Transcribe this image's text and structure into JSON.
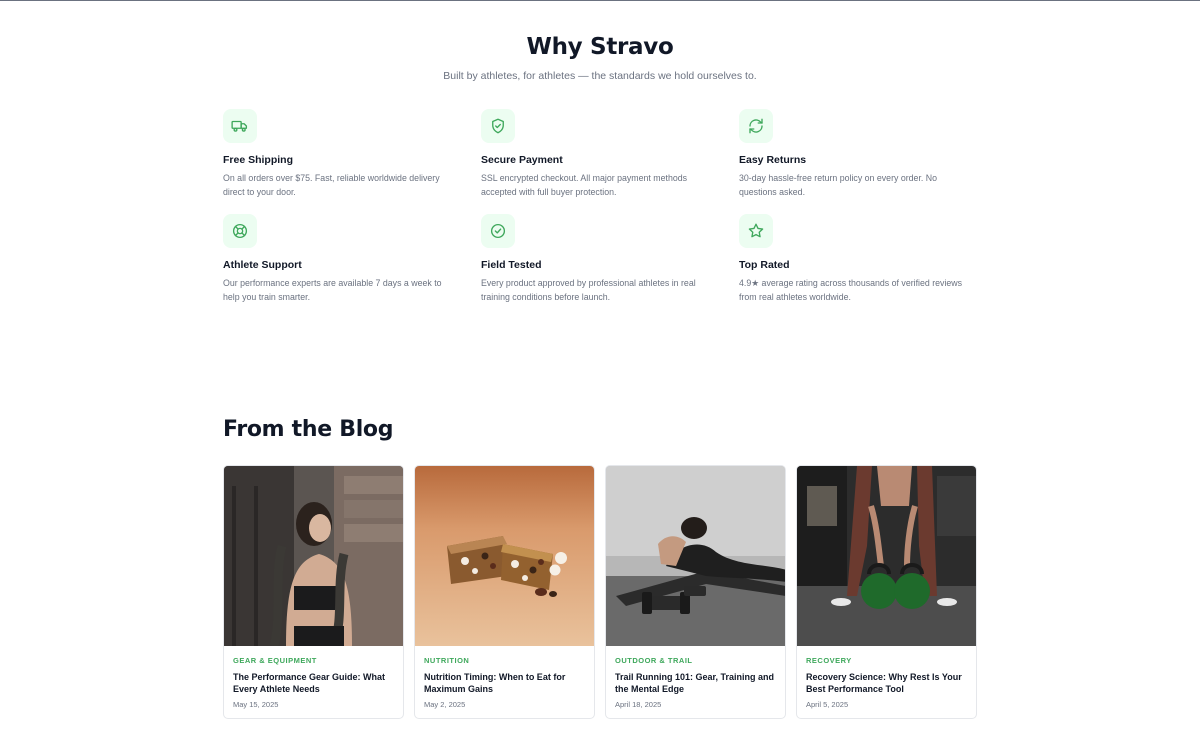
{
  "why": {
    "title": "Why Stravo",
    "subtitle": "Built by athletes, for athletes — the standards we hold ourselves to.",
    "features": [
      {
        "icon": "truck-icon",
        "title": "Free Shipping",
        "desc": "On all orders over $75. Fast, reliable worldwide delivery direct to your door."
      },
      {
        "icon": "shield-icon",
        "title": "Secure Payment",
        "desc": "SSL encrypted checkout. All major payment methods accepted with full buyer protection."
      },
      {
        "icon": "refresh-icon",
        "title": "Easy Returns",
        "desc": "30-day hassle-free return policy on every order. No questions asked."
      },
      {
        "icon": "lifebuoy-icon",
        "title": "Athlete Support",
        "desc": "Our performance experts are available 7 days a week to help you train smarter."
      },
      {
        "icon": "check-circle-icon",
        "title": "Field Tested",
        "desc": "Every product approved by professional athletes in real training conditions before launch."
      },
      {
        "icon": "star-icon",
        "title": "Top Rated",
        "desc": "4.9★ average rating across thousands of verified reviews from real athletes worldwide."
      }
    ]
  },
  "blog": {
    "title": "From the Blog",
    "posts": [
      {
        "category": "Gear & Equipment",
        "title": "The Performance Gear Guide: What Every Athlete Needs",
        "date": "May 15, 2025"
      },
      {
        "category": "Nutrition",
        "title": "Nutrition Timing: When to Eat for Maximum Gains",
        "date": "May 2, 2025"
      },
      {
        "category": "Outdoor & Trail",
        "title": "Trail Running 101: Gear, Training and the Mental Edge",
        "date": "April 18, 2025"
      },
      {
        "category": "Recovery",
        "title": "Recovery Science: Why Rest Is Your Best Performance Tool",
        "date": "April 5, 2025"
      }
    ]
  },
  "colors": {
    "accent": "#3fa85c",
    "icon_bg": "#ecfdf1",
    "heading": "#111827",
    "muted": "#6b7280"
  }
}
